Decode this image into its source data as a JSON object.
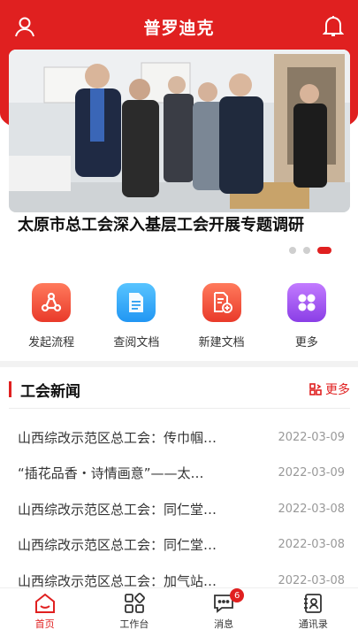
{
  "header": {
    "title": "普罗迪克"
  },
  "banner": {
    "headline": "太原市总工会深入基层工会开展专题调研",
    "dots": 3,
    "active_dot": 2
  },
  "quick_actions": [
    {
      "label": "发起流程",
      "icon": "share-flow-icon",
      "color": "#f0503a"
    },
    {
      "label": "查阅文档",
      "icon": "document-icon",
      "color": "#33a9ee"
    },
    {
      "label": "新建文档",
      "icon": "new-document-icon",
      "color": "#f0503a"
    },
    {
      "label": "更多",
      "icon": "grid-more-icon",
      "color": "#9b4de6"
    }
  ],
  "news": {
    "title": "工会新闻",
    "more_label": "更多",
    "items": [
      {
        "title": "山西综改示范区总工会：传巾帼…",
        "date": "2022-03-09"
      },
      {
        "title": "“插花品香・诗情画意”——太…",
        "date": "2022-03-09"
      },
      {
        "title": "山西综改示范区总工会：同仁堂…",
        "date": "2022-03-08"
      },
      {
        "title": "山西综改示范区总工会：同仁堂…",
        "date": "2022-03-08"
      },
      {
        "title": "山西综改示范区总工会：加气站…",
        "date": "2022-03-08"
      }
    ]
  },
  "tabbar": {
    "tabs": [
      {
        "label": "首页",
        "active": true
      },
      {
        "label": "工作台"
      },
      {
        "label": "消息",
        "badge": "6"
      },
      {
        "label": "通讯录"
      }
    ]
  },
  "colors": {
    "brand": "#e02020",
    "muted": "#999999"
  }
}
